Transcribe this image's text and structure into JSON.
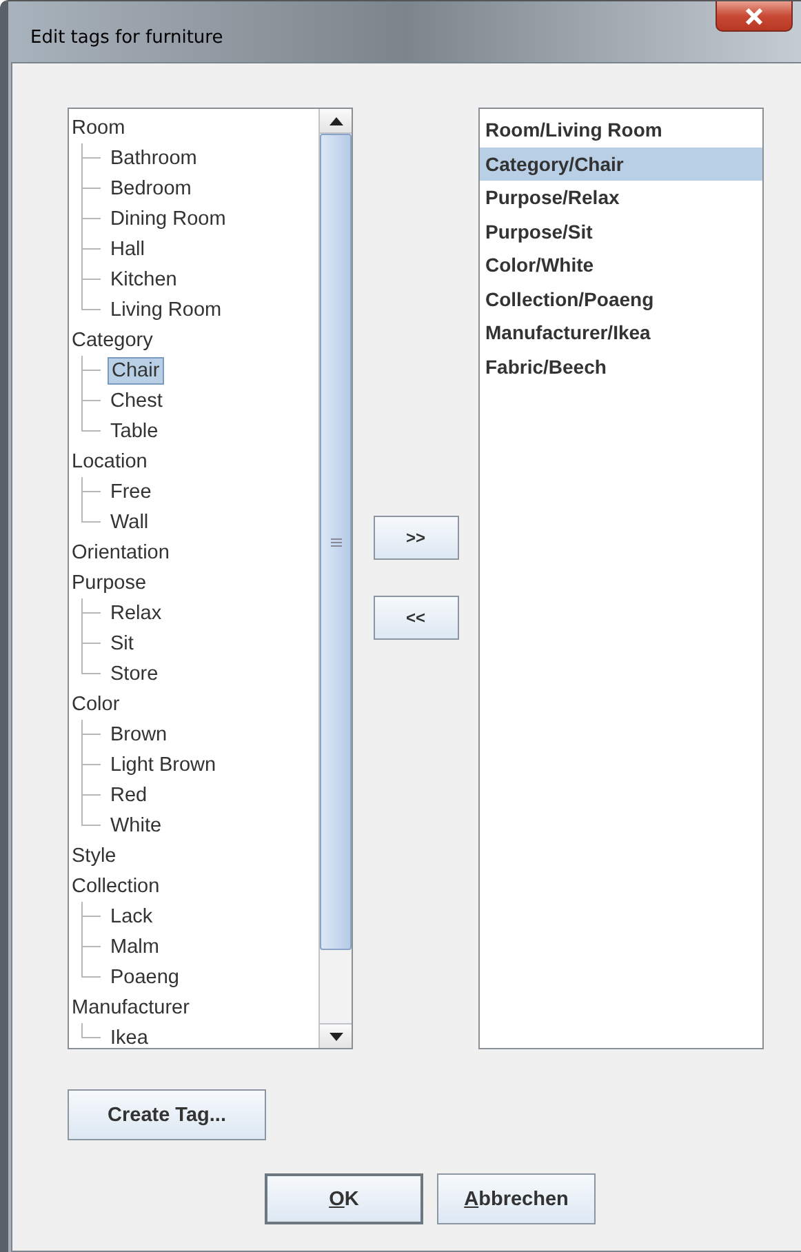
{
  "window": {
    "title": "Edit tags for furniture"
  },
  "tree": [
    {
      "label": "Room",
      "selected": false,
      "children": [
        {
          "label": "Bathroom",
          "selected": false
        },
        {
          "label": "Bedroom",
          "selected": false
        },
        {
          "label": "Dining Room",
          "selected": false
        },
        {
          "label": "Hall",
          "selected": false
        },
        {
          "label": "Kitchen",
          "selected": false
        },
        {
          "label": "Living Room",
          "selected": false
        }
      ]
    },
    {
      "label": "Category",
      "selected": false,
      "children": [
        {
          "label": "Chair",
          "selected": true
        },
        {
          "label": "Chest",
          "selected": false
        },
        {
          "label": "Table",
          "selected": false
        }
      ]
    },
    {
      "label": "Location",
      "selected": false,
      "children": [
        {
          "label": "Free",
          "selected": false
        },
        {
          "label": "Wall",
          "selected": false
        }
      ]
    },
    {
      "label": "Orientation",
      "selected": false
    },
    {
      "label": "Purpose",
      "selected": false,
      "children": [
        {
          "label": "Relax",
          "selected": false
        },
        {
          "label": "Sit",
          "selected": false
        },
        {
          "label": "Store",
          "selected": false
        }
      ]
    },
    {
      "label": "Color",
      "selected": false,
      "children": [
        {
          "label": "Brown",
          "selected": false
        },
        {
          "label": "Light Brown",
          "selected": false
        },
        {
          "label": "Red",
          "selected": false
        },
        {
          "label": "White",
          "selected": false
        }
      ]
    },
    {
      "label": "Style",
      "selected": false
    },
    {
      "label": "Collection",
      "selected": false,
      "children": [
        {
          "label": "Lack",
          "selected": false
        },
        {
          "label": "Malm",
          "selected": false
        },
        {
          "label": "Poaeng",
          "selected": false
        }
      ]
    },
    {
      "label": "Manufacturer",
      "selected": false,
      "children": [
        {
          "label": "Ikea",
          "selected": false
        }
      ]
    }
  ],
  "transfer_buttons": [
    ">>",
    "<<"
  ],
  "assigned_tags": [
    {
      "label": "Room/Living Room",
      "selected": false
    },
    {
      "label": "Category/Chair",
      "selected": true
    },
    {
      "label": "Purpose/Relax",
      "selected": false
    },
    {
      "label": "Purpose/Sit",
      "selected": false
    },
    {
      "label": "Color/White",
      "selected": false
    },
    {
      "label": "Collection/Poaeng",
      "selected": false
    },
    {
      "label": "Manufacturer/Ikea",
      "selected": false
    },
    {
      "label": "Fabric/Beech",
      "selected": false
    }
  ],
  "create_button": "Create Tag...",
  "buttons": [
    {
      "label": "OK"
    },
    {
      "label": "Abbrechen"
    }
  ]
}
